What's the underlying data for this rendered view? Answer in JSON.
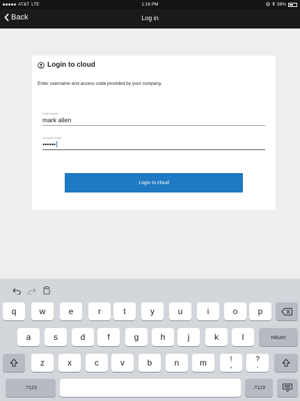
{
  "status_bar": {
    "carrier": "AT&T",
    "network": "LTE",
    "time": "1:16 PM",
    "battery": "58%",
    "battery_level": 0.58
  },
  "nav": {
    "back_label": "Back",
    "title": "Log in"
  },
  "card": {
    "title": "Login to cloud",
    "description": "Enter username and access code provided by your company.",
    "username": {
      "label": "Username",
      "value": "mark allen"
    },
    "access_code": {
      "label": "Access code",
      "value": "••••••"
    },
    "login_button": "Login to cloud"
  },
  "keyboard": {
    "row1": [
      "q",
      "w",
      "e",
      "r",
      "t",
      "y",
      "u",
      "i",
      "o",
      "p"
    ],
    "row2": [
      "a",
      "s",
      "d",
      "f",
      "g",
      "h",
      "j",
      "k",
      "l"
    ],
    "row2_return": "return",
    "row3": [
      "z",
      "x",
      "c",
      "v",
      "b",
      "n",
      "m"
    ],
    "punct1_top": "!",
    "punct1_bottom": ",",
    "punct2_top": "?",
    "punct2_bottom": ".",
    "numbers_key": ".?123"
  },
  "colors": {
    "accent": "#1f7ac3",
    "nav_bg": "#1b1b1b",
    "keyboard_bg": "#d3d6db"
  }
}
